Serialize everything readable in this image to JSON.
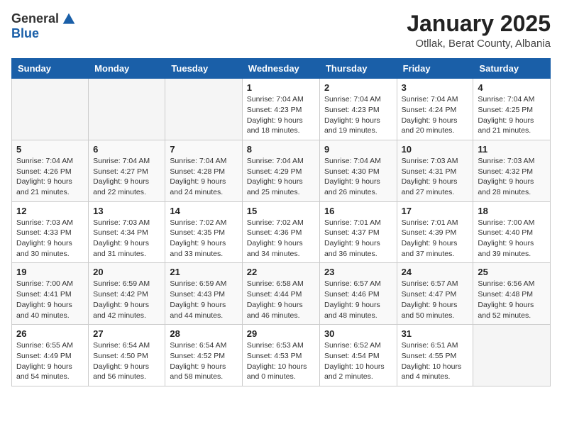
{
  "header": {
    "logo_general": "General",
    "logo_blue": "Blue",
    "month_title": "January 2025",
    "location": "Otllak, Berat County, Albania"
  },
  "days_of_week": [
    "Sunday",
    "Monday",
    "Tuesday",
    "Wednesday",
    "Thursday",
    "Friday",
    "Saturday"
  ],
  "weeks": [
    [
      {
        "num": "",
        "sunrise": "",
        "sunset": "",
        "daylight": ""
      },
      {
        "num": "",
        "sunrise": "",
        "sunset": "",
        "daylight": ""
      },
      {
        "num": "",
        "sunrise": "",
        "sunset": "",
        "daylight": ""
      },
      {
        "num": "1",
        "sunrise": "7:04 AM",
        "sunset": "4:23 PM",
        "daylight": "9 hours and 18 minutes."
      },
      {
        "num": "2",
        "sunrise": "7:04 AM",
        "sunset": "4:23 PM",
        "daylight": "9 hours and 19 minutes."
      },
      {
        "num": "3",
        "sunrise": "7:04 AM",
        "sunset": "4:24 PM",
        "daylight": "9 hours and 20 minutes."
      },
      {
        "num": "4",
        "sunrise": "7:04 AM",
        "sunset": "4:25 PM",
        "daylight": "9 hours and 21 minutes."
      }
    ],
    [
      {
        "num": "5",
        "sunrise": "7:04 AM",
        "sunset": "4:26 PM",
        "daylight": "9 hours and 21 minutes."
      },
      {
        "num": "6",
        "sunrise": "7:04 AM",
        "sunset": "4:27 PM",
        "daylight": "9 hours and 22 minutes."
      },
      {
        "num": "7",
        "sunrise": "7:04 AM",
        "sunset": "4:28 PM",
        "daylight": "9 hours and 24 minutes."
      },
      {
        "num": "8",
        "sunrise": "7:04 AM",
        "sunset": "4:29 PM",
        "daylight": "9 hours and 25 minutes."
      },
      {
        "num": "9",
        "sunrise": "7:04 AM",
        "sunset": "4:30 PM",
        "daylight": "9 hours and 26 minutes."
      },
      {
        "num": "10",
        "sunrise": "7:03 AM",
        "sunset": "4:31 PM",
        "daylight": "9 hours and 27 minutes."
      },
      {
        "num": "11",
        "sunrise": "7:03 AM",
        "sunset": "4:32 PM",
        "daylight": "9 hours and 28 minutes."
      }
    ],
    [
      {
        "num": "12",
        "sunrise": "7:03 AM",
        "sunset": "4:33 PM",
        "daylight": "9 hours and 30 minutes."
      },
      {
        "num": "13",
        "sunrise": "7:03 AM",
        "sunset": "4:34 PM",
        "daylight": "9 hours and 31 minutes."
      },
      {
        "num": "14",
        "sunrise": "7:02 AM",
        "sunset": "4:35 PM",
        "daylight": "9 hours and 33 minutes."
      },
      {
        "num": "15",
        "sunrise": "7:02 AM",
        "sunset": "4:36 PM",
        "daylight": "9 hours and 34 minutes."
      },
      {
        "num": "16",
        "sunrise": "7:01 AM",
        "sunset": "4:37 PM",
        "daylight": "9 hours and 36 minutes."
      },
      {
        "num": "17",
        "sunrise": "7:01 AM",
        "sunset": "4:39 PM",
        "daylight": "9 hours and 37 minutes."
      },
      {
        "num": "18",
        "sunrise": "7:00 AM",
        "sunset": "4:40 PM",
        "daylight": "9 hours and 39 minutes."
      }
    ],
    [
      {
        "num": "19",
        "sunrise": "7:00 AM",
        "sunset": "4:41 PM",
        "daylight": "9 hours and 40 minutes."
      },
      {
        "num": "20",
        "sunrise": "6:59 AM",
        "sunset": "4:42 PM",
        "daylight": "9 hours and 42 minutes."
      },
      {
        "num": "21",
        "sunrise": "6:59 AM",
        "sunset": "4:43 PM",
        "daylight": "9 hours and 44 minutes."
      },
      {
        "num": "22",
        "sunrise": "6:58 AM",
        "sunset": "4:44 PM",
        "daylight": "9 hours and 46 minutes."
      },
      {
        "num": "23",
        "sunrise": "6:57 AM",
        "sunset": "4:46 PM",
        "daylight": "9 hours and 48 minutes."
      },
      {
        "num": "24",
        "sunrise": "6:57 AM",
        "sunset": "4:47 PM",
        "daylight": "9 hours and 50 minutes."
      },
      {
        "num": "25",
        "sunrise": "6:56 AM",
        "sunset": "4:48 PM",
        "daylight": "9 hours and 52 minutes."
      }
    ],
    [
      {
        "num": "26",
        "sunrise": "6:55 AM",
        "sunset": "4:49 PM",
        "daylight": "9 hours and 54 minutes."
      },
      {
        "num": "27",
        "sunrise": "6:54 AM",
        "sunset": "4:50 PM",
        "daylight": "9 hours and 56 minutes."
      },
      {
        "num": "28",
        "sunrise": "6:54 AM",
        "sunset": "4:52 PM",
        "daylight": "9 hours and 58 minutes."
      },
      {
        "num": "29",
        "sunrise": "6:53 AM",
        "sunset": "4:53 PM",
        "daylight": "10 hours and 0 minutes."
      },
      {
        "num": "30",
        "sunrise": "6:52 AM",
        "sunset": "4:54 PM",
        "daylight": "10 hours and 2 minutes."
      },
      {
        "num": "31",
        "sunrise": "6:51 AM",
        "sunset": "4:55 PM",
        "daylight": "10 hours and 4 minutes."
      },
      {
        "num": "",
        "sunrise": "",
        "sunset": "",
        "daylight": ""
      }
    ]
  ]
}
